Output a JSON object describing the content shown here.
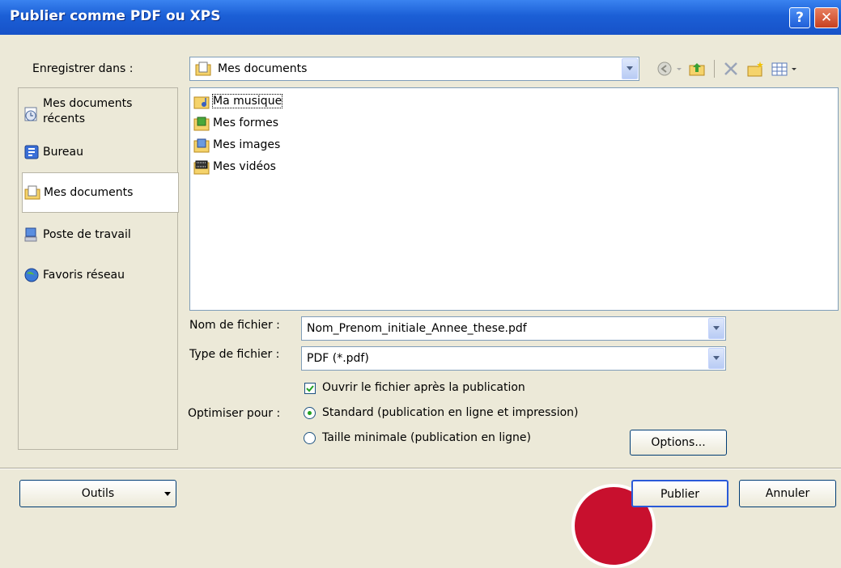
{
  "window": {
    "title": "Publier comme PDF ou XPS",
    "help_label": "?",
    "close_label": "✕"
  },
  "location": {
    "label": "Enregistrer dans :",
    "value": "Mes documents"
  },
  "places": [
    {
      "label": "Mes documents\nrécents",
      "icon": "recent-documents-icon"
    },
    {
      "label": "Bureau",
      "icon": "desktop-icon"
    },
    {
      "label": "Mes documents",
      "icon": "my-documents-icon"
    },
    {
      "label": "Poste de travail",
      "icon": "my-computer-icon"
    },
    {
      "label": "Favoris réseau",
      "icon": "network-places-icon"
    }
  ],
  "files": [
    {
      "name": "Ma musique",
      "icon": "music-folder-icon"
    },
    {
      "name": "Mes formes",
      "icon": "shapes-folder-icon"
    },
    {
      "name": "Mes images",
      "icon": "pictures-folder-icon"
    },
    {
      "name": "Mes vidéos",
      "icon": "videos-folder-icon"
    }
  ],
  "filename": {
    "label": "Nom de fichier :",
    "value": "Nom_Prenom_initiale_Annee_these.pdf"
  },
  "filetype": {
    "label": "Type de fichier :",
    "value": "PDF (*.pdf)"
  },
  "open_after": {
    "label": "Ouvrir le fichier après la publication",
    "checked": true
  },
  "optimize": {
    "label": "Optimiser pour :",
    "standard_label": "Standard (publication en ligne et impression)",
    "minimal_label": "Taille minimale (publication en ligne)",
    "selected": "standard"
  },
  "buttons": {
    "options": "Options...",
    "tools": "Outils",
    "publish": "Publier",
    "cancel": "Annuler"
  },
  "colors": {
    "titlebar": "#1b5fd6",
    "dialog_bg": "#ece9d8",
    "accent_red": "#c8102e"
  }
}
